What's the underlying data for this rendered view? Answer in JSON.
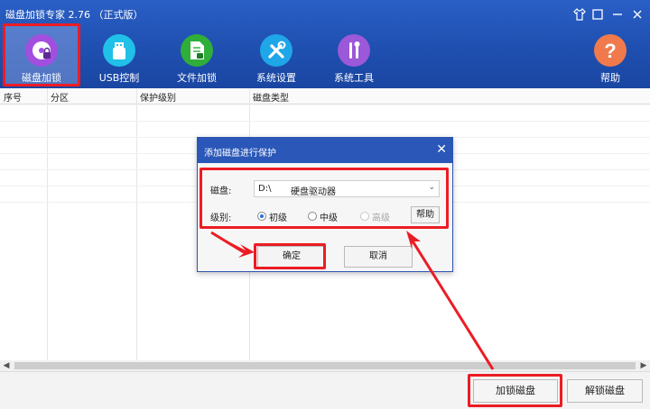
{
  "app": {
    "title": "磁盘加锁专家 2.76 （正式版）"
  },
  "window_controls": {
    "skin": "shirt-icon",
    "min": "minimize-icon",
    "close": "close-icon"
  },
  "toolbar": {
    "items": [
      {
        "label": "磁盘加锁",
        "icon": "disk-lock-icon",
        "color": "#a24fe0",
        "active": true
      },
      {
        "label": "USB控制",
        "icon": "usb-icon",
        "color": "#20c0e8"
      },
      {
        "label": "文件加锁",
        "icon": "file-lock-icon",
        "color": "#2fae3a"
      },
      {
        "label": "系统设置",
        "icon": "tools-icon",
        "color": "#1ea6e8"
      },
      {
        "label": "系统工具",
        "icon": "toolbox-icon",
        "color": "#9b58d8"
      },
      {
        "label": "帮助",
        "icon": "help-icon",
        "color": "#f07a4c"
      }
    ]
  },
  "table": {
    "headers": [
      "序号",
      "分区",
      "保护级别",
      "磁盘类型"
    ]
  },
  "bottom": {
    "lock_label": "加锁磁盘",
    "unlock_label": "解锁磁盘"
  },
  "dialog": {
    "title": "添加磁盘进行保护",
    "disk_label": "磁盘:",
    "disk_drive": "D:\\",
    "disk_type": "硬盘驱动器",
    "level_label": "级别:",
    "levels": [
      "初级",
      "中级",
      "高级"
    ],
    "selected_level": "初级",
    "help_label": "帮助",
    "ok_label": "确定",
    "cancel_label": "取消"
  },
  "colors": {
    "accent_red": "#ec1c24",
    "toolbar_blue": "#1f4fb0"
  }
}
